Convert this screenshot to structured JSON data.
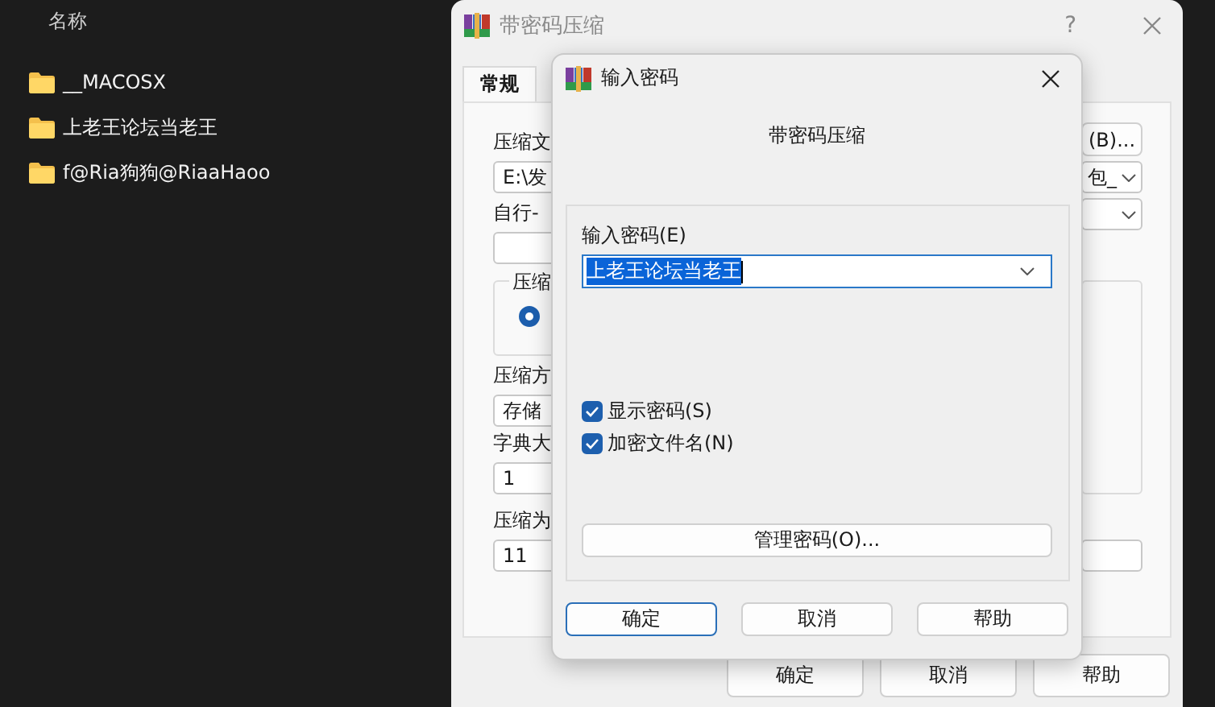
{
  "explorer": {
    "column_header": "名称",
    "items": [
      {
        "name": "__MACOSX"
      },
      {
        "name": "上老王论坛当老王"
      },
      {
        "name": "f@Ria狗狗@RiaaHaoo"
      }
    ]
  },
  "archive_dialog": {
    "title": "带密码压缩",
    "help": "?",
    "tabs": [
      {
        "label": "常规",
        "selected": true
      }
    ],
    "archive_label": "压缩文",
    "browse_button": "(B)...",
    "archive_path": "E:\\发",
    "profile_value": "包_",
    "volume_label": "自行-",
    "format_label": "压缩",
    "format_radio": {
      "selected": true
    },
    "method_label": "压缩方",
    "method_value": "存储",
    "dictionary_label": "字典大",
    "dictionary_value": "1",
    "split_label": "压缩为",
    "split_value": "11",
    "buttons": [
      {
        "label": "确定"
      },
      {
        "label": "取消"
      },
      {
        "label": "帮助"
      }
    ]
  },
  "password_dialog": {
    "title": "输入密码",
    "heading": "带密码压缩",
    "password_label": "输入密码(E)",
    "password_value": "上老王论坛当老王",
    "options": [
      {
        "label": "显示密码(S)",
        "checked": true
      },
      {
        "label": "加密文件名(N)",
        "checked": true
      }
    ],
    "manage_button": "管理密码(O)...",
    "buttons": [
      {
        "label": "确定",
        "focused": true
      },
      {
        "label": "取消",
        "focused": false
      },
      {
        "label": "帮助",
        "focused": false
      }
    ]
  }
}
